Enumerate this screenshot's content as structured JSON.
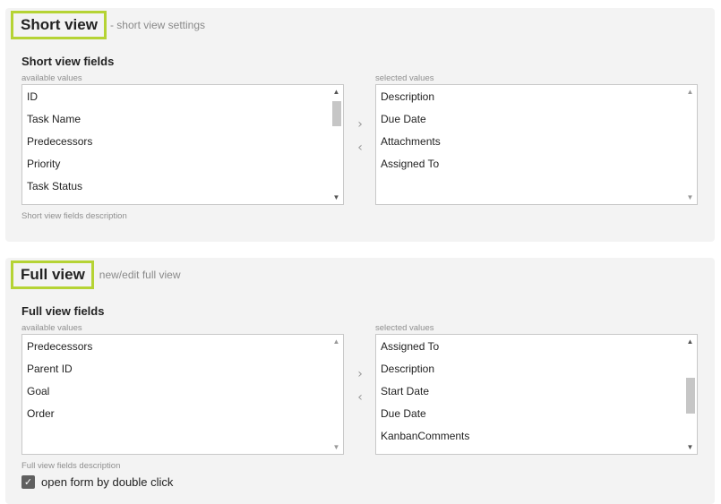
{
  "short_view": {
    "title": "Short view",
    "subtitle": "- short view settings",
    "fields_label": "Short view fields",
    "available_label": "available values",
    "selected_label": "selected values",
    "available_values": [
      "ID",
      "Task Name",
      "Predecessors",
      "Priority",
      "Task Status"
    ],
    "selected_values": [
      "Description",
      "Due Date",
      "Attachments",
      "Assigned To"
    ],
    "description": "Short view fields description",
    "move_right": "›",
    "move_left": "‹"
  },
  "full_view": {
    "title": "Full view",
    "subtitle": "new/edit full view",
    "fields_label": "Full view fields",
    "available_label": "available values",
    "selected_label": "selected values",
    "available_values": [
      "Predecessors",
      "Parent ID",
      "Goal",
      "Order"
    ],
    "selected_values": [
      "Assigned To",
      "Description",
      "Start Date",
      "Due Date",
      "KanbanComments"
    ],
    "description": "Full view fields description",
    "move_right": "›",
    "move_left": "‹"
  },
  "options": {
    "open_form_double_click_label": "open form by double click",
    "open_form_double_click_checked": true
  },
  "icons": {
    "scroll_up": "▲",
    "scroll_down": "▼",
    "check": "✓"
  },
  "colors": {
    "highlight_border": "#b5d334",
    "panel_bg": "#f3f3f3"
  }
}
